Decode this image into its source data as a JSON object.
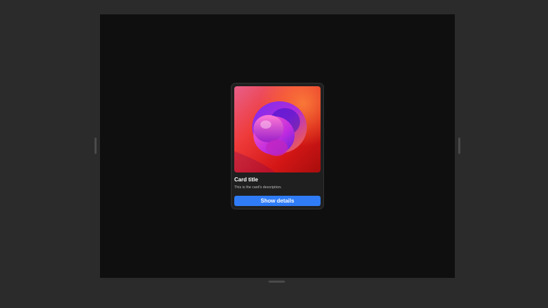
{
  "card": {
    "title": "Card title",
    "description": "This is the card's description.",
    "button_label": "Show details",
    "image_icon": "abstract-3d-shape-image"
  },
  "colors": {
    "background": "#2b2b2b",
    "canvas": "#0f0f0f",
    "card": "#1f1f1f",
    "accent": "#2f7cf6"
  }
}
